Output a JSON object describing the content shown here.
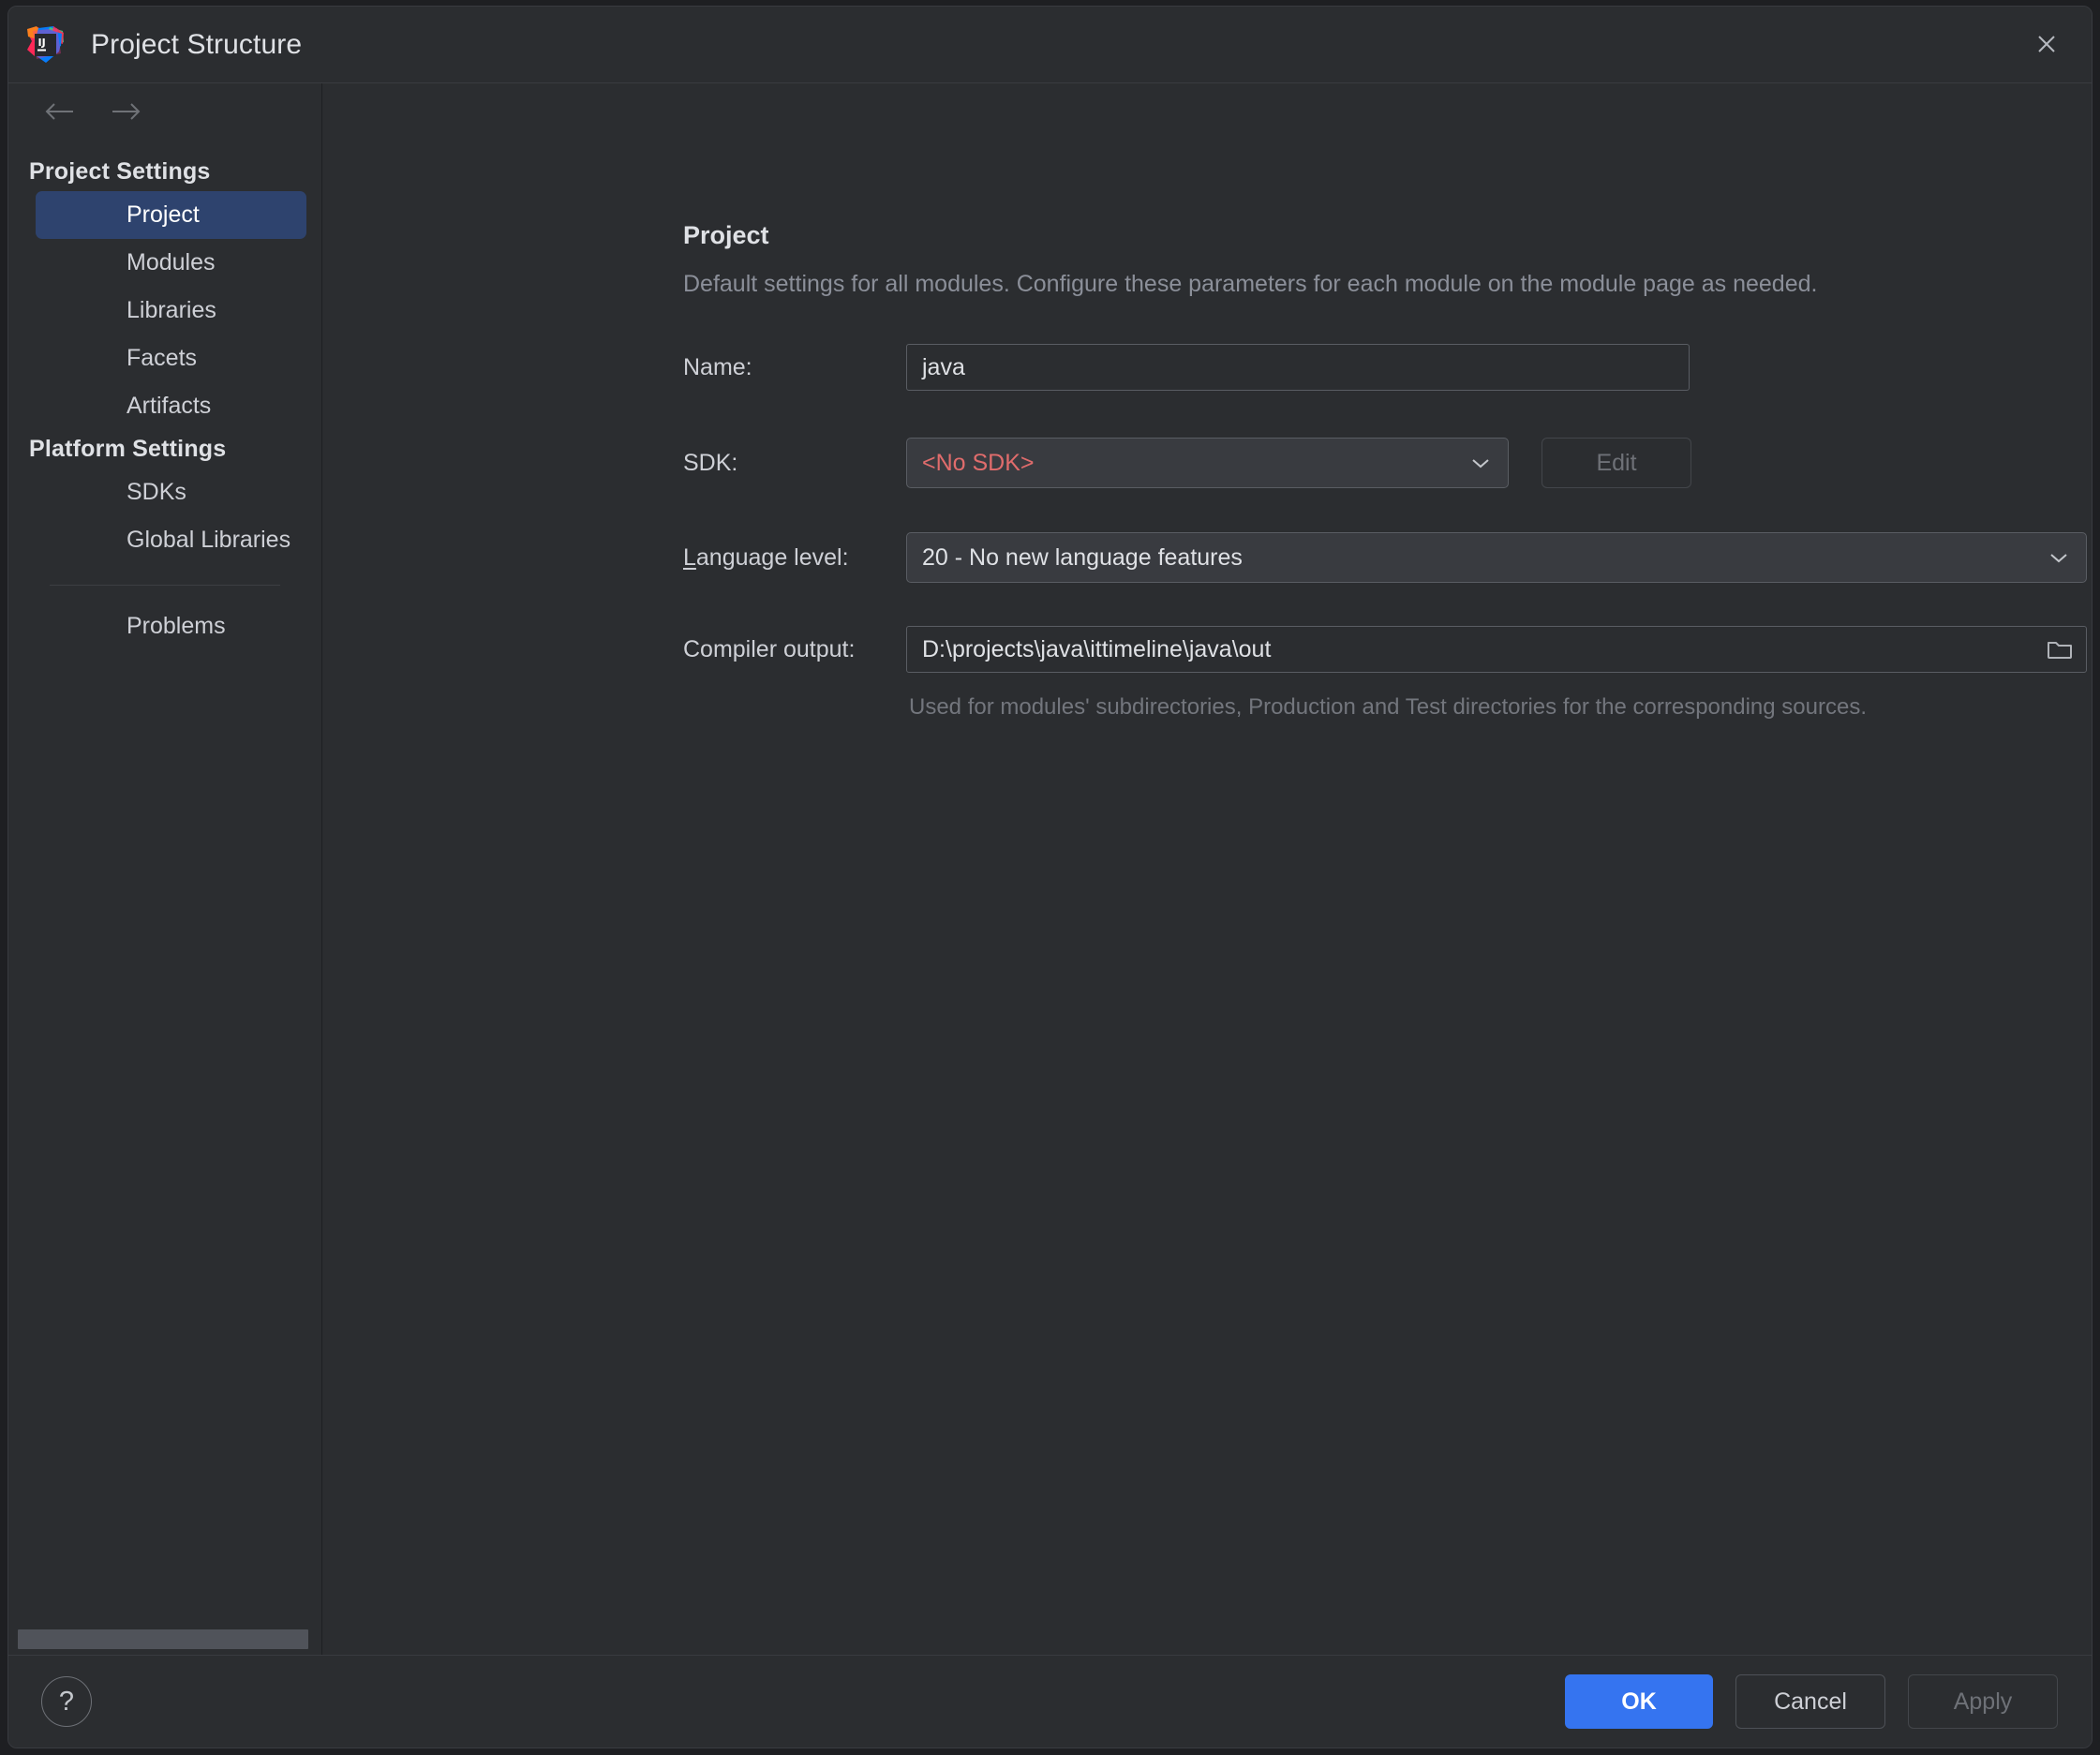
{
  "window": {
    "title": "Project Structure",
    "logo_icon": "intellij-idea-logo",
    "close_icon": "close-icon"
  },
  "nav": {
    "back_icon": "arrow-left-icon",
    "forward_icon": "arrow-right-icon"
  },
  "sidebar": {
    "groups": [
      {
        "title": "Project Settings",
        "items": [
          {
            "label": "Project",
            "selected": true
          },
          {
            "label": "Modules",
            "selected": false
          },
          {
            "label": "Libraries",
            "selected": false
          },
          {
            "label": "Facets",
            "selected": false
          },
          {
            "label": "Artifacts",
            "selected": false
          }
        ]
      },
      {
        "title": "Platform Settings",
        "items": [
          {
            "label": "SDKs",
            "selected": false
          },
          {
            "label": "Global Libraries",
            "selected": false
          }
        ]
      }
    ],
    "extra_items": [
      {
        "label": "Problems",
        "selected": false
      }
    ]
  },
  "main": {
    "title": "Project",
    "description": "Default settings for all modules. Configure these parameters for each module on the module page as needed.",
    "name": {
      "label": "Name:",
      "value": "java",
      "placeholder": ""
    },
    "sdk": {
      "label": "SDK:",
      "value": "<No SDK>",
      "chevron_icon": "chevron-down-icon",
      "edit_button": "Edit",
      "edit_enabled": false
    },
    "language_level": {
      "label": "Language level:",
      "label_mnemonic": "L",
      "label_rest": "anguage level:",
      "value": "20 - No new language features",
      "chevron_icon": "chevron-down-icon"
    },
    "compiler_output": {
      "label": "Compiler output:",
      "value": "D:\\projects\\java\\ittimeline\\java\\out",
      "browse_icon": "folder-icon",
      "hint": "Used for modules' subdirectories, Production and Test directories for the corresponding sources."
    }
  },
  "footer": {
    "help_icon": "question-mark-icon",
    "help_label": "?",
    "ok_label": "OK",
    "cancel_label": "Cancel",
    "apply_label": "Apply",
    "apply_enabled": false
  },
  "colors": {
    "background": "#2b2d30",
    "selection": "#2e436e",
    "primary": "#3574f0",
    "error": "#e06c6c",
    "text": "#dfe1e5",
    "muted": "#8b8f99"
  }
}
